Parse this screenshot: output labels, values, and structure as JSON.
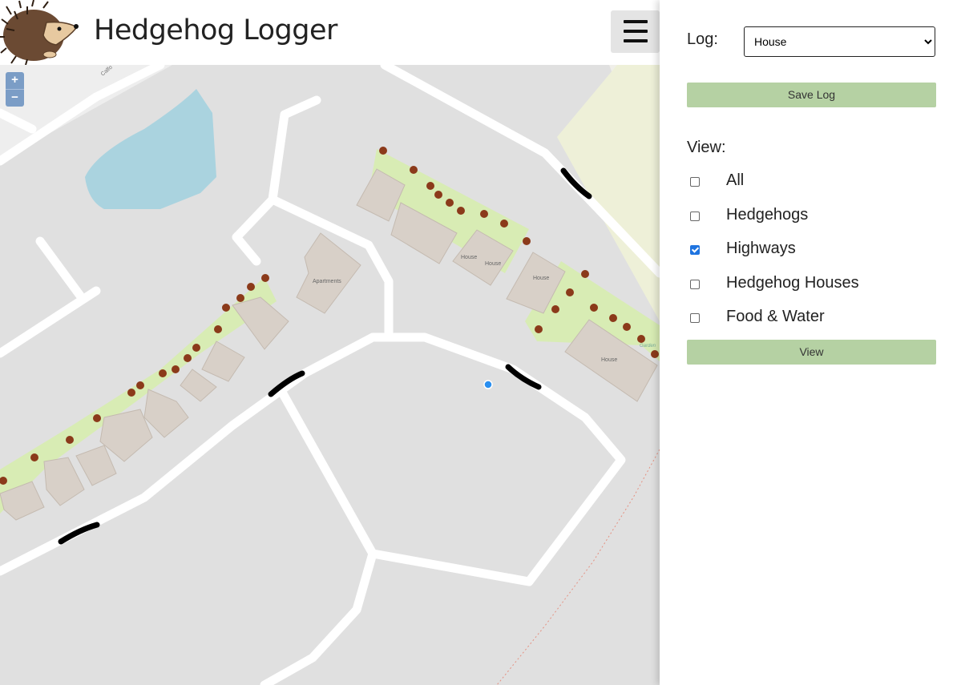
{
  "header": {
    "title": "Hedgehog Logger",
    "menu_icon": "hamburger-menu-icon",
    "logo_icon": "hedgehog-logo"
  },
  "map": {
    "zoom_in_label": "+",
    "zoom_out_label": "−",
    "labels": {
      "apartments": "Apartments",
      "house": "House",
      "garden": "Garden",
      "street": "Calfo"
    },
    "colors": {
      "background": "#e0e0e0",
      "road": "#ffffff",
      "garden": "#d8ecb4",
      "building": "#d8d0c8",
      "water": "#aad3df",
      "hedge_dot": "#8b3a1a",
      "highway_mark": "#000000",
      "location_dot": "#2a8ff0"
    }
  },
  "panel": {
    "log_label": "Log:",
    "log_value": "House",
    "save_button": "Save Log",
    "view_label": "View:",
    "options": [
      {
        "label": "All",
        "checked": false
      },
      {
        "label": "Hedgehogs",
        "checked": false
      },
      {
        "label": "Highways",
        "checked": true
      },
      {
        "label": "Hedgehog Houses",
        "checked": false
      },
      {
        "label": "Food & Water",
        "checked": false
      }
    ],
    "view_button": "View",
    "accent": "#b5d1a3"
  }
}
